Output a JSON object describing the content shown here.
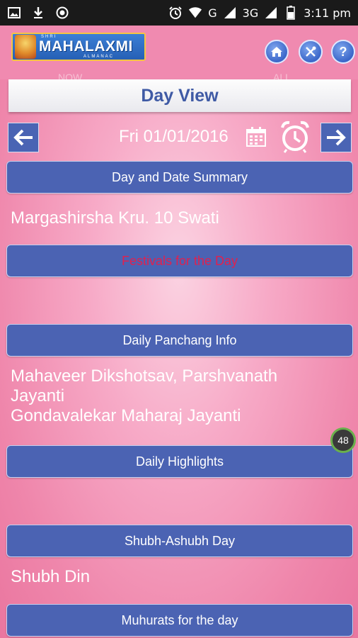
{
  "statusbar": {
    "time": "3:11 pm",
    "network": "3G",
    "signal_label": "G",
    "icons": [
      "gallery-icon",
      "download-icon",
      "sync-icon",
      "alarm-icon",
      "wifi-icon",
      "signal-icon",
      "battery-icon"
    ]
  },
  "header": {
    "logo_top": "SHRI",
    "logo_name": "MAHALAXMI",
    "logo_sub": "ALMANAC",
    "buttons": [
      "home-icon",
      "tools-icon",
      "help-icon"
    ],
    "faint_tabs": [
      "NOW",
      "",
      "ALL"
    ]
  },
  "title": "Day View",
  "date_nav": {
    "date": "Fri 01/01/2016",
    "prev_icon": "arrow-left-icon",
    "next_icon": "arrow-right-icon",
    "calendar_icon": "calendar-icon",
    "alarm_icon": "alarm-clock-icon"
  },
  "sections": {
    "summary_label": "Day and Date Summary",
    "summary_text": "Margashirsha Kru. 10 Swati",
    "festivals_label": "Festivals for the Day",
    "panchang_label": "Daily Panchang Info",
    "panchang_text_line1": "Mahaveer Dikshotsav, Parshvanath",
    "panchang_text_line2": "Jayanti",
    "panchang_text_line3": "Gondavalekar Maharaj Jayanti",
    "highlights_label": "Daily Highlights",
    "shubh_label": "Shubh-Ashubh Day",
    "shubh_text": "Shubh Din",
    "muhurat_label": "Muhurats for the day"
  },
  "badge": "48",
  "colors": {
    "button_blue": "#4b63b3",
    "title_blue": "#3f5aa5",
    "festival_red": "#e0214f",
    "background_pink": "#f7aac7"
  }
}
